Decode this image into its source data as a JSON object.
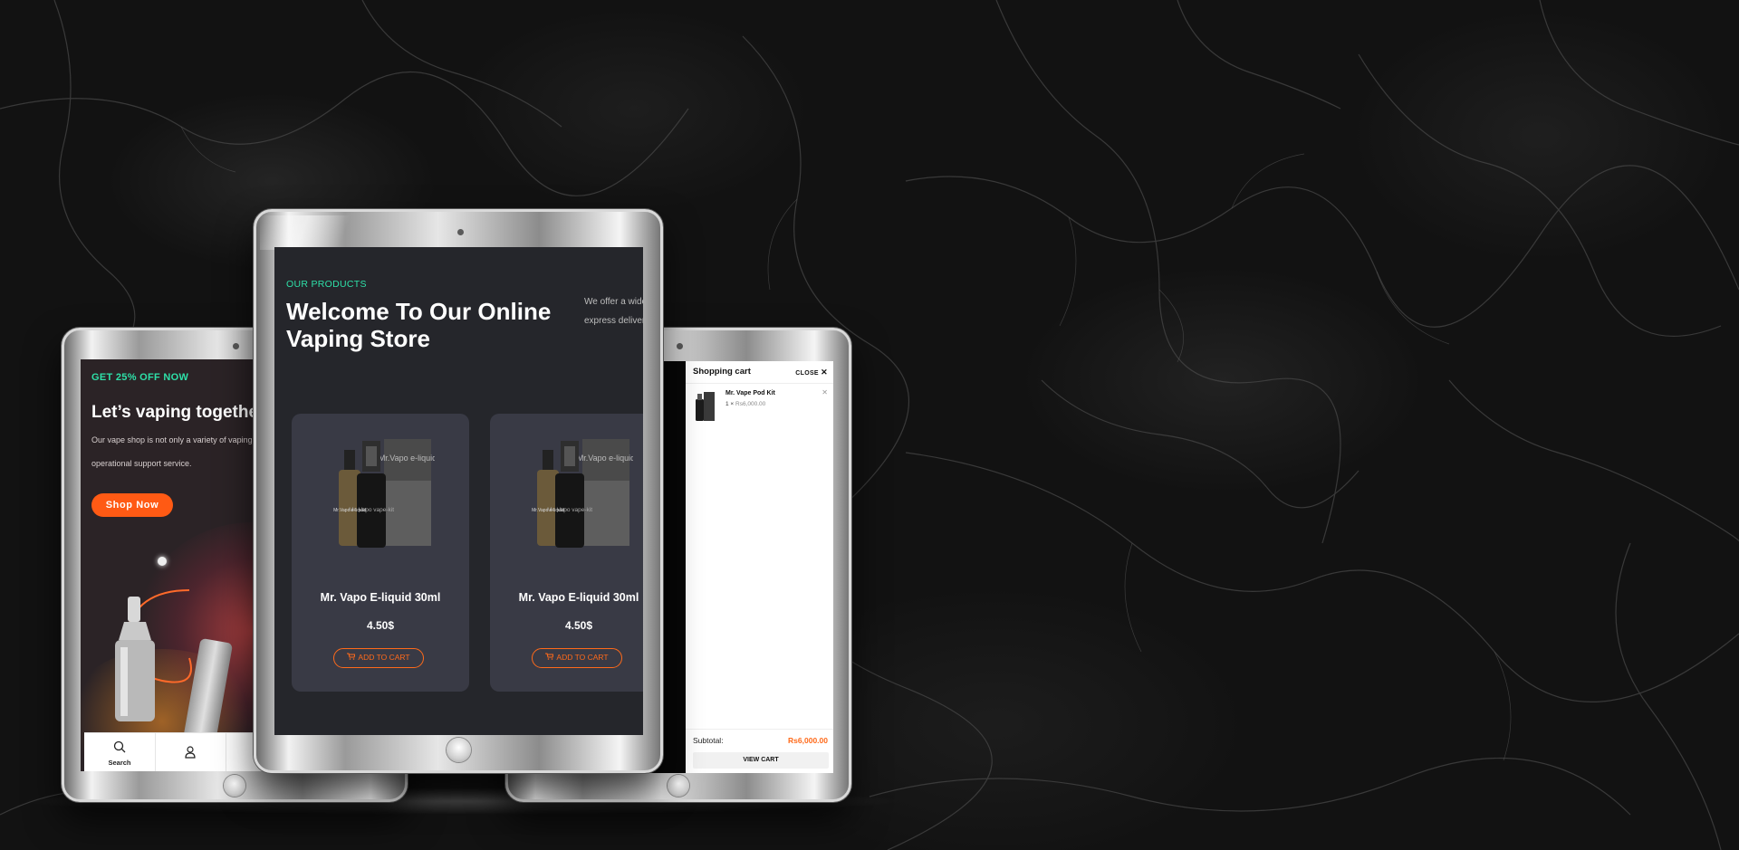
{
  "left_screen": {
    "promo": "GET 25% OFF NOW",
    "title": "Let’s vaping together",
    "description_lines": [
      "Our vape shop is not only a variety of vaping",
      "operational support service."
    ],
    "cta": "Shop Now",
    "nav": [
      {
        "icon": "search-icon",
        "label": "Search"
      },
      {
        "icon": "user-icon",
        "label": ""
      }
    ]
  },
  "middle_screen": {
    "eyebrow": "OUR PRODUCTS",
    "title_lines": [
      "Welcome To Our Online",
      "Vaping Store"
    ],
    "description_lines": [
      "We offer a wide",
      "express deliver"
    ],
    "products": [
      {
        "name": "Mr. Vapo E-liquid 30ml",
        "price": "4.50$",
        "button": "ADD TO CART",
        "box_text": "Mr.Vapo e-liquid",
        "bottle_text": "Mr. Vapo vape-kit",
        "small_bottle_text": "Mr.Vapo e-liquid"
      },
      {
        "name": "Mr. Vapo E-liquid 30ml",
        "price": "4.50$",
        "button": "ADD TO CART",
        "box_text": "Mr.Vapo e-liquid",
        "bottle_text": "Mr. Vapo vape-kit",
        "small_bottle_text": "Mr.Vapo e-liquid"
      }
    ]
  },
  "right_screen": {
    "cart_title": "Shopping cart",
    "close_label": "CLOSE",
    "items": [
      {
        "name": "Mr. Vape Pod Kit",
        "qty": "1 ×",
        "price": "Rs6,000.00"
      }
    ],
    "subtotal_label": "Subtotal:",
    "subtotal_value": "Rs6,000.00",
    "view_cart": "VIEW CART"
  },
  "colors": {
    "accent_green": "#2ee0a8",
    "accent_orange": "#ff6a1a",
    "cta_orange": "#ff5a14",
    "card_bg": "#393a45",
    "screen_bg": "#25262b"
  }
}
